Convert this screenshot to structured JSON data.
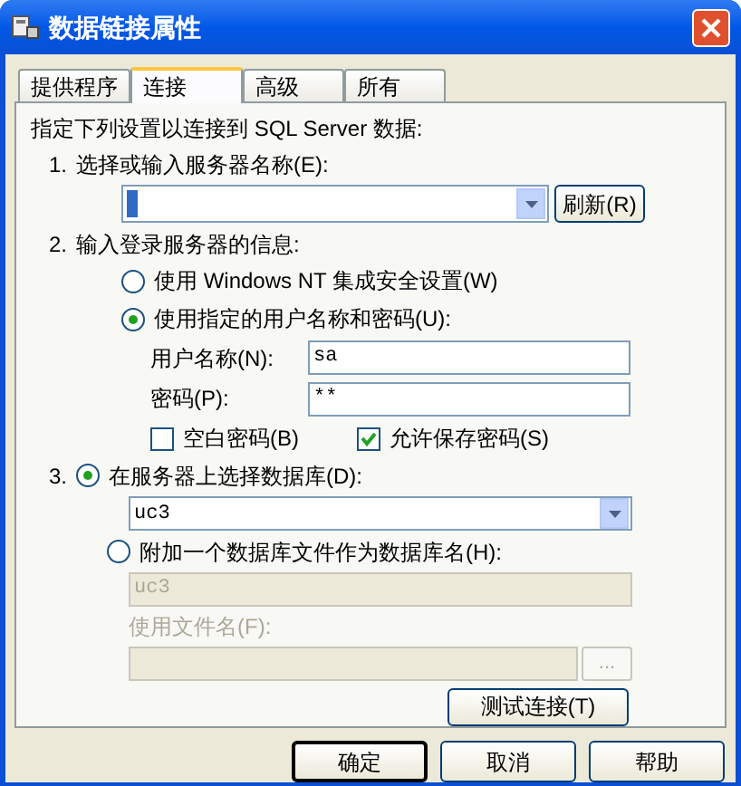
{
  "window": {
    "title": "数据链接属性"
  },
  "tabs": [
    {
      "label": "提供程序",
      "selected": false
    },
    {
      "label": "连接",
      "selected": true
    },
    {
      "label": "高级",
      "selected": false
    },
    {
      "label": "所有",
      "selected": false
    }
  ],
  "intro": "指定下列设置以连接到 SQL Server 数据:",
  "step1": {
    "number": "1.",
    "label": "选择或输入服务器名称(E):",
    "refresh_button": "刷新(R)"
  },
  "step2": {
    "number": "2.",
    "label": "输入登录服务器的信息:",
    "options": [
      {
        "label": "使用 Windows NT 集成安全设置(W)",
        "selected": false
      },
      {
        "label": "使用指定的用户名称和密码(U):",
        "selected": true
      }
    ],
    "username_label": "用户名称(N):",
    "username_value": "sa",
    "password_label": "密码(P):",
    "password_value": "**",
    "checkboxes": [
      {
        "label": "空白密码(B)",
        "checked": false
      },
      {
        "label": "允许保存密码(S)",
        "checked": true
      }
    ]
  },
  "step3": {
    "number": "3.",
    "select_option": {
      "label": "在服务器上选择数据库(D):",
      "selected": true
    },
    "database_value": "uc3",
    "attach_option": {
      "label": "附加一个数据库文件作为数据库名(H):",
      "selected": false
    },
    "attach": {
      "disabled": true,
      "name_value": "uc3",
      "file_label": "使用文件名(F):",
      "browse_button": "..."
    },
    "test_button": "测试连接(T)"
  },
  "buttons": [
    {
      "label": "确定",
      "default": true
    },
    {
      "label": "取消",
      "default": false
    },
    {
      "label": "帮助",
      "default": false
    }
  ]
}
